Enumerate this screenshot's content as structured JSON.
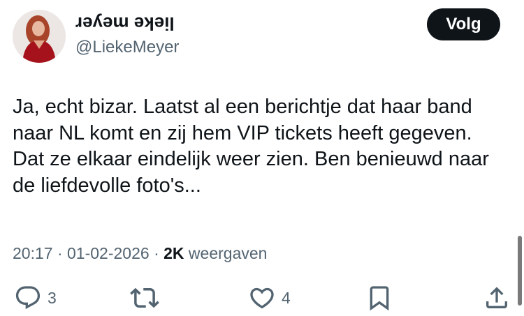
{
  "author": {
    "display_name": "lieke meyer",
    "handle": "@LiekeMeyer",
    "avatar_icon": "profile-photo"
  },
  "follow_button": {
    "label": "Volg"
  },
  "tweet": {
    "lines": [
      "Ja, echt bizar. Laatst al een berichtje dat haar band",
      "naar NL komt en zij hem VIP tickets heeft gegeven.",
      "Dat ze elkaar eindelijk weer zien. Ben benieuwd naar",
      "de liefdevolle foto's..."
    ]
  },
  "meta": {
    "time": "20:17",
    "date": "01-02-2026",
    "separator": "·",
    "views_count": "2K",
    "views_label": "weergaven"
  },
  "actions": {
    "reply": {
      "icon": "reply-icon",
      "count": "3"
    },
    "retweet": {
      "icon": "retweet-icon",
      "count": ""
    },
    "like": {
      "icon": "heart-icon",
      "count": "4"
    },
    "bookmark": {
      "icon": "bookmark-icon"
    },
    "share": {
      "icon": "share-icon"
    }
  },
  "colors": {
    "text_primary": "#0f1419",
    "text_secondary": "#536471",
    "button_bg": "#0f1419",
    "button_text": "#ffffff",
    "background": "#ffffff"
  }
}
